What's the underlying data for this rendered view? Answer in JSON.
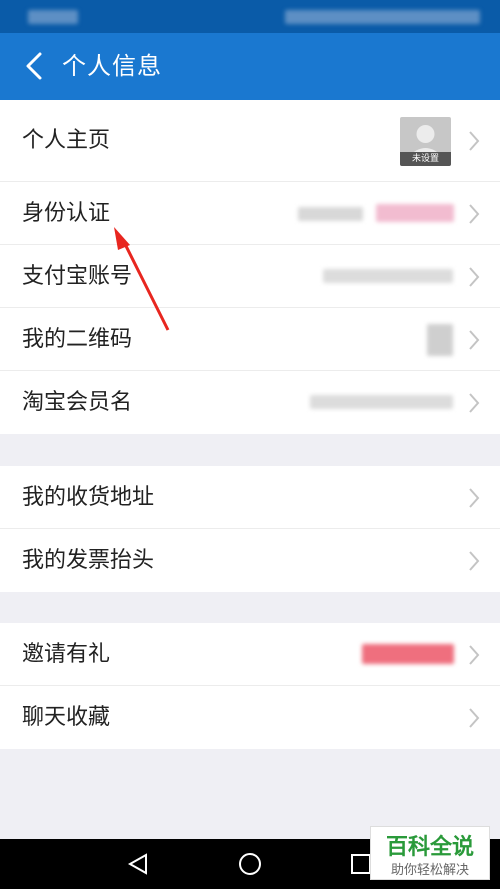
{
  "header": {
    "title": "个人信息"
  },
  "group1": [
    {
      "label": "个人主页"
    },
    {
      "label": "身份认证"
    },
    {
      "label": "支付宝账号"
    },
    {
      "label": "我的二维码"
    },
    {
      "label": "淘宝会员名"
    }
  ],
  "group2": [
    {
      "label": "我的收货地址"
    },
    {
      "label": "我的发票抬头"
    }
  ],
  "group3": [
    {
      "label": "邀请有礼"
    },
    {
      "label": "聊天收藏"
    }
  ],
  "avatar": {
    "caption": "未设置"
  },
  "watermark": {
    "title": "百科全说",
    "subtitle": "助你轻松解决"
  },
  "colors": {
    "header": "#1a78d0",
    "status_bar": "#0a5ba8",
    "annotation_arrow": "#e8261f",
    "watermark_green": "#2a9a3a"
  }
}
